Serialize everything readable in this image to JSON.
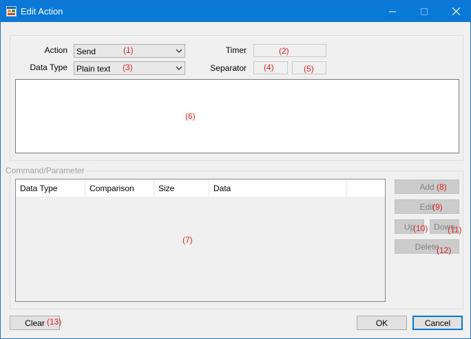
{
  "window": {
    "title": "Edit Action",
    "minimize_glyph": "—",
    "maximize_glyph": "☐",
    "close_glyph": "✕"
  },
  "top": {
    "action_label": "Action",
    "action_value": "Send",
    "action_num": "(1)",
    "timer_label": "Timer",
    "timer_num": "(2)",
    "datatype_label": "Data Type",
    "datatype_value": "Plain text",
    "datatype_num": "(3)",
    "separator_label": "Separator",
    "sep1_num": "(4)",
    "sep2_num": "(5)",
    "textarea_num": "(6)"
  },
  "command": {
    "group_title": "Command/Parameter",
    "columns": [
      "Data Type",
      "Comparison",
      "Size",
      "Data"
    ],
    "list_num": "(7)",
    "add_label": "Add",
    "add_num": "(8)",
    "edit_label": "Edit",
    "edit_num": "(9)",
    "up_label": "Up",
    "up_num": "(10)",
    "down_label": "Down",
    "down_num": "(11)",
    "delete_label": "Delete",
    "delete_num": "(12)"
  },
  "footer": {
    "clear_label": "Clear",
    "clear_num": "(13)",
    "ok_label": "OK",
    "cancel_label": "Cancel"
  },
  "colors": {
    "titlebar": "#0a78d7",
    "annotation": "#e02020",
    "default_button_border": "#0078d7"
  },
  "icons": {
    "app": "app-window-icon",
    "dropdown": "chevron-down-icon"
  }
}
